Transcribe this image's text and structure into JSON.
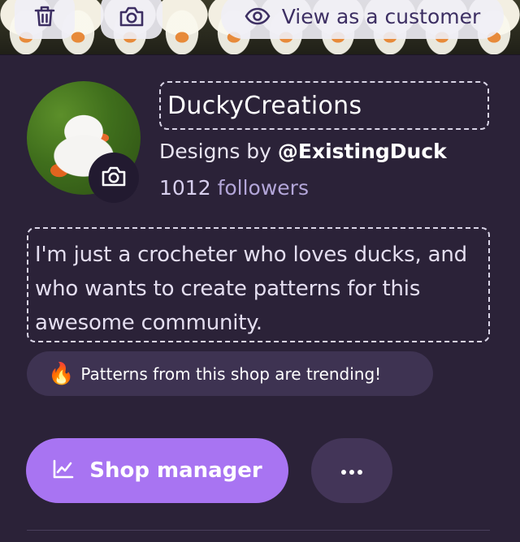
{
  "banner": {
    "view_as_customer_label": "View as a customer",
    "icons": [
      "trash-icon",
      "camera-icon",
      "eye-icon"
    ]
  },
  "profile": {
    "shop_name": "DuckyCreations",
    "designs_by_prefix": "Designs by ",
    "designs_by_handle": "@ExistingDuck",
    "followers_count": "1012",
    "followers_label": " followers",
    "avatar_icon": "camera-icon"
  },
  "bio": {
    "text": "I'm just a crocheter who loves ducks, and who wants to create patterns for this awesome community."
  },
  "trending": {
    "emoji": "🔥",
    "text": "Patterns from this shop are trending!"
  },
  "actions": {
    "shop_manager_label": "Shop manager",
    "shop_manager_icon": "chart-icon",
    "more_icon": "more-horizontal-icon"
  },
  "colors": {
    "background": "#2b2238",
    "accent": "#a874f2",
    "pill": "#3e3352"
  }
}
